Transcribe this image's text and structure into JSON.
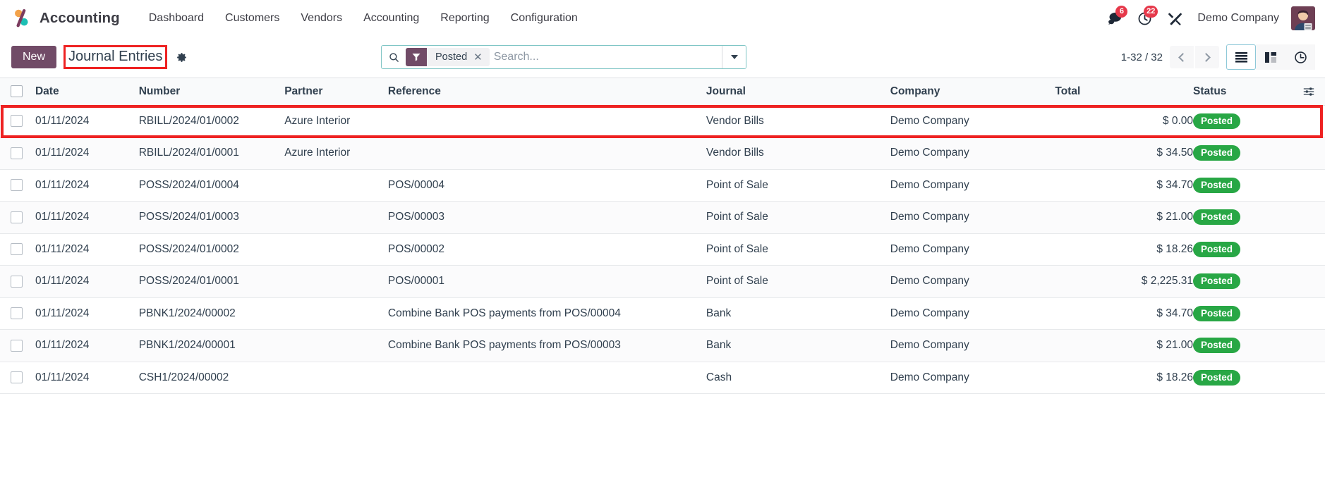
{
  "navbar": {
    "brand": "Accounting",
    "brand_logo_icon": "odoo-accounting-logo-icon",
    "menu": [
      {
        "label": "Dashboard"
      },
      {
        "label": "Customers"
      },
      {
        "label": "Vendors"
      },
      {
        "label": "Accounting"
      },
      {
        "label": "Reporting"
      },
      {
        "label": "Configuration"
      }
    ],
    "systray": {
      "messages_icon": "chat-bubble-icon",
      "messages_count": "6",
      "activities_icon": "clock-icon",
      "activities_count": "22",
      "tools_icon": "wrench-screwdriver-icon",
      "company": "Demo Company",
      "avatar_icon": "user-avatar"
    }
  },
  "control_panel": {
    "new_button": "New",
    "breadcrumb": "Journal Entries",
    "settings_icon": "gear-icon",
    "search": {
      "search_icon": "search-icon",
      "facet_icon": "filter-funnel-icon",
      "facet_label": "Posted",
      "facet_remove_icon": "close-icon",
      "placeholder": "Search...",
      "value": "",
      "toggle_icon": "chevron-down-icon"
    },
    "pager": {
      "range": "1-32 / 32",
      "prev_icon": "chevron-left-icon",
      "next_icon": "chevron-right-icon"
    },
    "view_switcher": [
      {
        "name": "list",
        "icon": "list-view-icon",
        "active": true
      },
      {
        "name": "kanban",
        "icon": "kanban-view-icon",
        "active": false
      },
      {
        "name": "activity",
        "icon": "activity-clock-view-icon",
        "active": false
      }
    ]
  },
  "list": {
    "columns": {
      "select_all": "select-all-checkbox",
      "date": "Date",
      "number": "Number",
      "partner": "Partner",
      "reference": "Reference",
      "journal": "Journal",
      "company": "Company",
      "total": "Total",
      "status": "Status",
      "optional_icon": "column-options-icon"
    },
    "highlighted_row_index": 0,
    "rows": [
      {
        "date": "01/11/2024",
        "number": "RBILL/2024/01/0002",
        "partner": "Azure Interior",
        "reference": "",
        "journal": "Vendor Bills",
        "company": "Demo Company",
        "total": "$ 0.00",
        "status": "Posted"
      },
      {
        "date": "01/11/2024",
        "number": "RBILL/2024/01/0001",
        "partner": "Azure Interior",
        "reference": "",
        "journal": "Vendor Bills",
        "company": "Demo Company",
        "total": "$ 34.50",
        "status": "Posted"
      },
      {
        "date": "01/11/2024",
        "number": "POSS/2024/01/0004",
        "partner": "",
        "reference": "POS/00004",
        "journal": "Point of Sale",
        "company": "Demo Company",
        "total": "$ 34.70",
        "status": "Posted"
      },
      {
        "date": "01/11/2024",
        "number": "POSS/2024/01/0003",
        "partner": "",
        "reference": "POS/00003",
        "journal": "Point of Sale",
        "company": "Demo Company",
        "total": "$ 21.00",
        "status": "Posted"
      },
      {
        "date": "01/11/2024",
        "number": "POSS/2024/01/0002",
        "partner": "",
        "reference": "POS/00002",
        "journal": "Point of Sale",
        "company": "Demo Company",
        "total": "$ 18.26",
        "status": "Posted"
      },
      {
        "date": "01/11/2024",
        "number": "POSS/2024/01/0001",
        "partner": "",
        "reference": "POS/00001",
        "journal": "Point of Sale",
        "company": "Demo Company",
        "total": "$ 2,225.31",
        "status": "Posted"
      },
      {
        "date": "01/11/2024",
        "number": "PBNK1/2024/00002",
        "partner": "",
        "reference": "Combine Bank POS payments from POS/00004",
        "journal": "Bank",
        "company": "Demo Company",
        "total": "$ 34.70",
        "status": "Posted"
      },
      {
        "date": "01/11/2024",
        "number": "PBNK1/2024/00001",
        "partner": "",
        "reference": "Combine Bank POS payments from POS/00003",
        "journal": "Bank",
        "company": "Demo Company",
        "total": "$ 21.00",
        "status": "Posted"
      },
      {
        "date": "01/11/2024",
        "number": "CSH1/2024/00002",
        "partner": "",
        "reference": "",
        "journal": "Cash",
        "company": "Demo Company",
        "total": "$ 18.26",
        "status": "Posted"
      }
    ]
  },
  "colors": {
    "brand_purple": "#714b67",
    "status_green": "#28a745",
    "badge_red": "#e6394b",
    "highlight_red": "#ee2222",
    "search_border": "#7fc5c5"
  }
}
